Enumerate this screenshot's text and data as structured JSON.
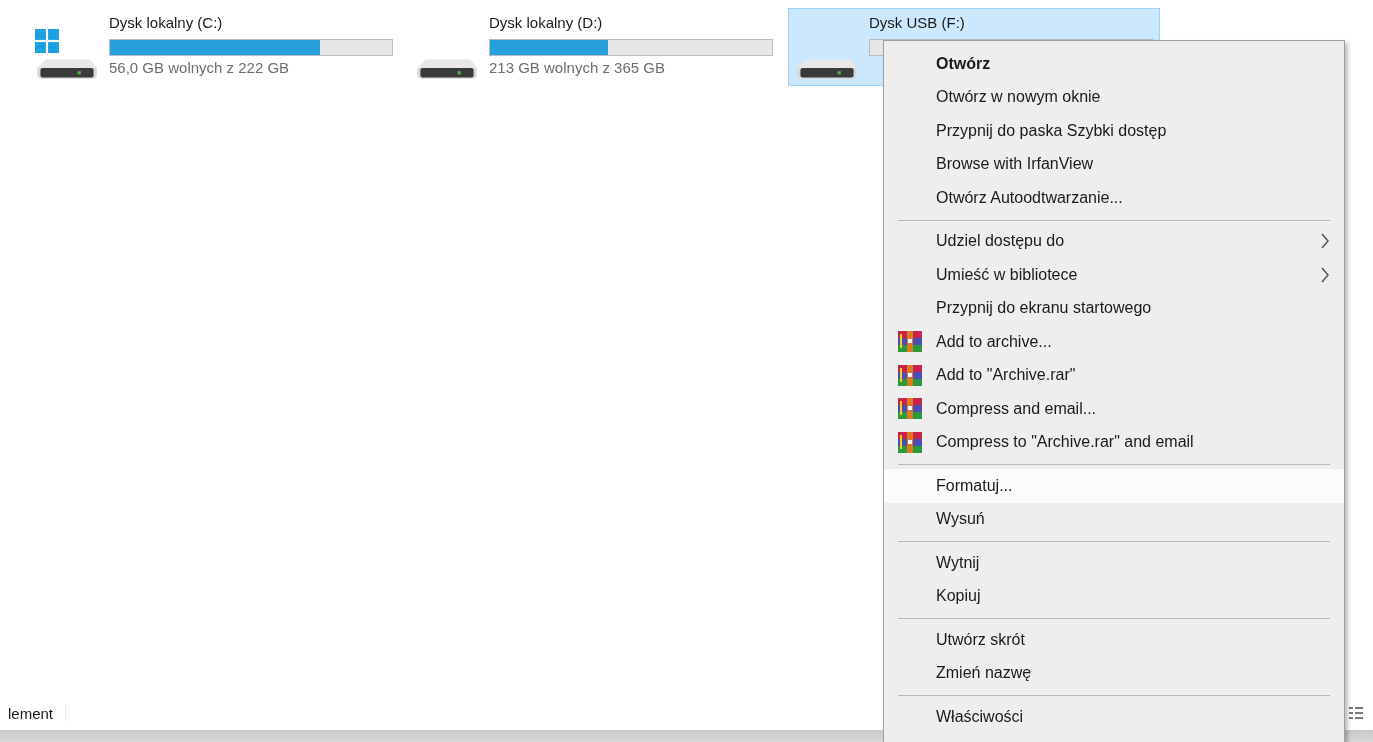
{
  "drives": [
    {
      "name": "Dysk lokalny (C:)",
      "system": true,
      "selected": false,
      "level": 0.745,
      "free_text": "56,0 GB wolnych z 222 GB"
    },
    {
      "name": "Dysk lokalny (D:)",
      "system": false,
      "selected": false,
      "level": 0.42,
      "free_text": "213 GB wolnych z 365 GB"
    },
    {
      "name": "Dysk USB (F:)",
      "system": false,
      "selected": true
    }
  ],
  "context_menu": {
    "items": [
      {
        "kind": "item",
        "label": "Otwórz",
        "bold": true,
        "selected": false
      },
      {
        "kind": "item",
        "label": "Otwórz w nowym oknie",
        "selected": false
      },
      {
        "kind": "item",
        "label": "Przypnij do paska Szybki dostęp",
        "selected": false
      },
      {
        "kind": "item",
        "label": "Browse with IrfanView",
        "selected": false
      },
      {
        "kind": "item",
        "label": "Otwórz Autoodtwarzanie...",
        "selected": false
      },
      {
        "kind": "separator"
      },
      {
        "kind": "item",
        "label": "Udziel dostępu do",
        "submenu": true,
        "selected": false
      },
      {
        "kind": "item",
        "label": "Umieść w bibliotece",
        "submenu": true,
        "selected": false
      },
      {
        "kind": "item",
        "label": "Przypnij do ekranu startowego",
        "selected": false
      },
      {
        "kind": "archive_item",
        "label": "Add to archive...",
        "selected": false
      },
      {
        "kind": "archive_item",
        "label": "Add to \"Archive.rar\"",
        "selected": false
      },
      {
        "kind": "archive_item",
        "label": "Compress and email...",
        "selected": false
      },
      {
        "kind": "archive_item",
        "label": "Compress to \"Archive.rar\" and email",
        "selected": false
      },
      {
        "kind": "separator"
      },
      {
        "kind": "item",
        "label": "Formatuj...",
        "selected": true
      },
      {
        "kind": "item",
        "label": "Wysuń",
        "selected": false
      },
      {
        "kind": "separator"
      },
      {
        "kind": "item",
        "label": "Wytnij",
        "selected": false
      },
      {
        "kind": "item",
        "label": "Kopiuj",
        "selected": false
      },
      {
        "kind": "separator"
      },
      {
        "kind": "item",
        "label": "Utwórz skrót",
        "selected": false
      },
      {
        "kind": "item",
        "label": "Zmień nazwę",
        "selected": false
      },
      {
        "kind": "separator"
      },
      {
        "kind": "item",
        "label": "Właściwości",
        "selected": false
      }
    ]
  },
  "status_bar": {
    "text": "lement"
  }
}
